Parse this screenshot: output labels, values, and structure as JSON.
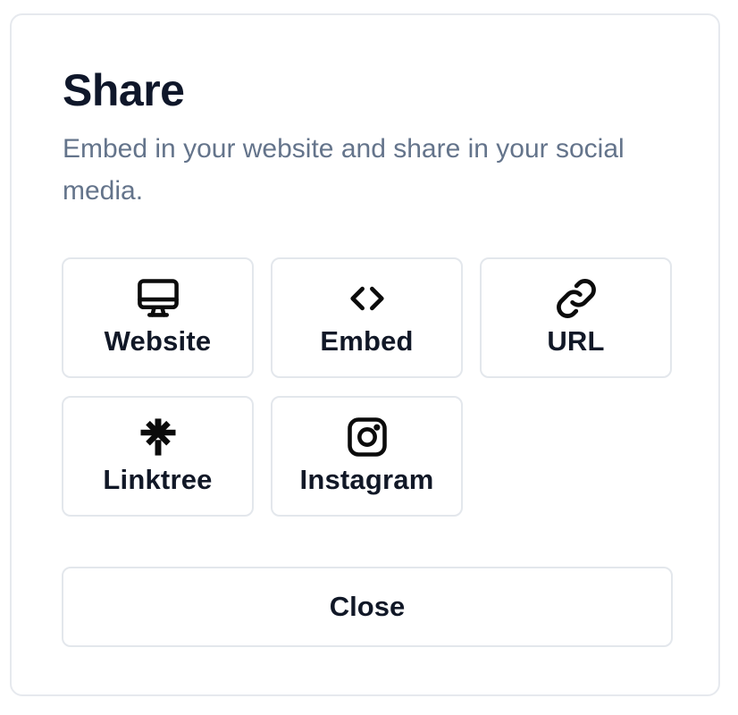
{
  "dialog": {
    "title": "Share",
    "subtitle": "Embed in your website and share in your social media."
  },
  "options": [
    {
      "label": "Website",
      "icon": "monitor-icon"
    },
    {
      "label": "Embed",
      "icon": "code-icon"
    },
    {
      "label": "URL",
      "icon": "link-icon"
    },
    {
      "label": "Linktree",
      "icon": "linktree-icon"
    },
    {
      "label": "Instagram",
      "icon": "instagram-icon"
    }
  ],
  "footer": {
    "close_label": "Close"
  },
  "colors": {
    "title": "#0f172a",
    "subtitle": "#64748b",
    "border": "#e3e7ec",
    "label": "#111827"
  }
}
